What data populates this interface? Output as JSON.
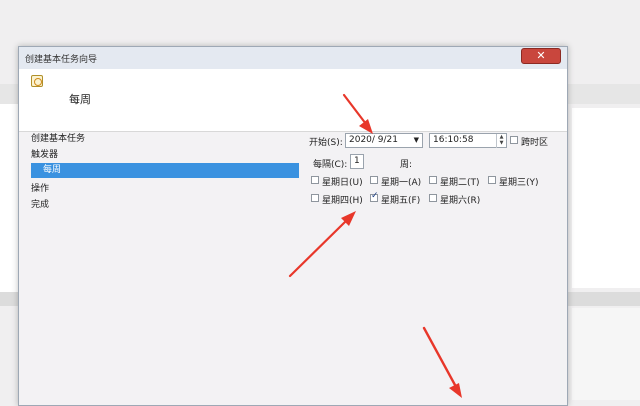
{
  "window": {
    "title": "创建基本任务向导",
    "close_label": "✕",
    "header_title": "每周"
  },
  "steps": [
    {
      "label": "创建基本任务",
      "selected": false
    },
    {
      "label": "触发器",
      "selected": false
    },
    {
      "label": "每周",
      "selected": true
    },
    {
      "label": "操作",
      "selected": false
    },
    {
      "label": "完成",
      "selected": false
    }
  ],
  "form": {
    "start_label": "开始(S):",
    "date_value": "2020/ 9/21",
    "time_value": "16:10:58",
    "sync_tz_label": "跨时区",
    "sync_tz_checked": false,
    "recur_label": "每隔(C):",
    "recur_value": "1",
    "weeks_label": "周:",
    "days": [
      {
        "label": "星期日(U)",
        "checked": false
      },
      {
        "label": "星期一(A)",
        "checked": false
      },
      {
        "label": "星期二(T)",
        "checked": false
      },
      {
        "label": "星期三(Y)",
        "checked": false
      },
      {
        "label": "星期四(H)",
        "checked": false
      },
      {
        "label": "星期五(F)",
        "checked": true
      },
      {
        "label": "星期六(R)",
        "checked": false
      }
    ]
  },
  "colors": {
    "selection": "#3a92e0",
    "annotation_arrow": "#e8372a",
    "close_button": "#c9463d"
  }
}
